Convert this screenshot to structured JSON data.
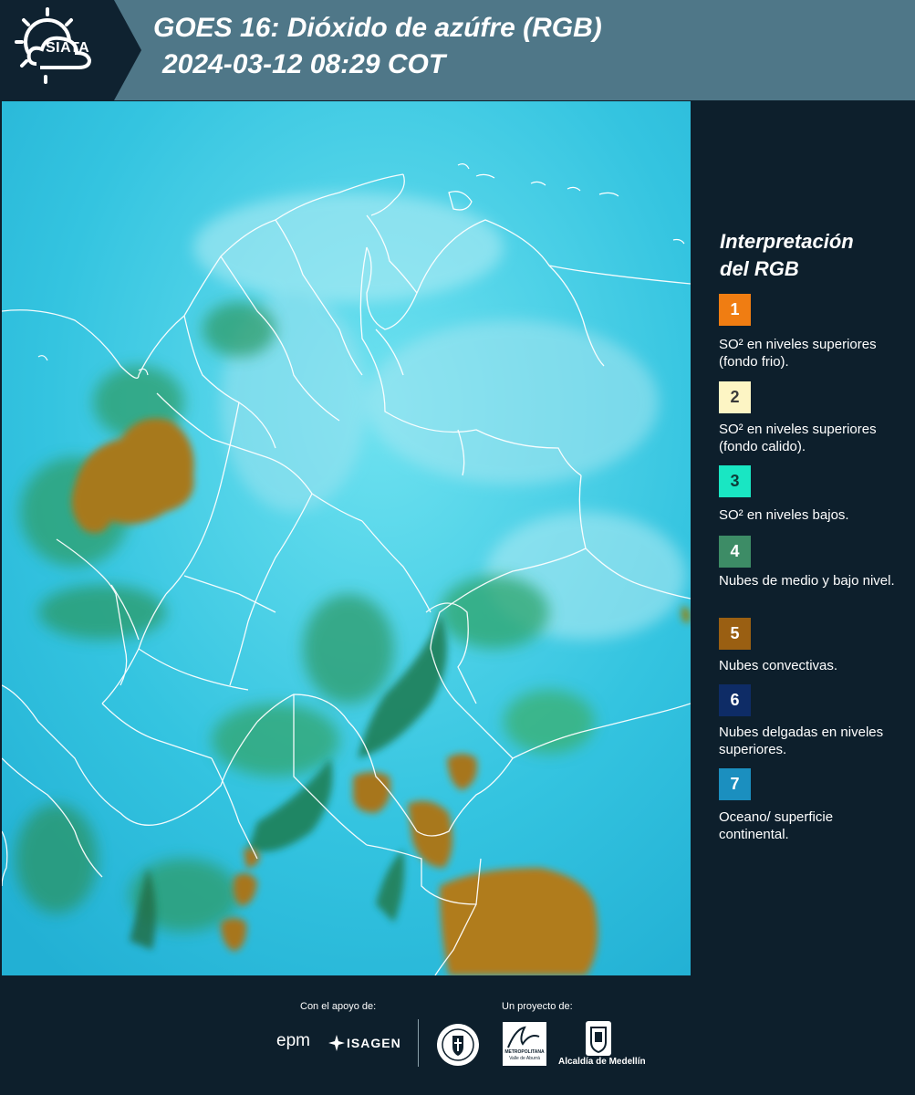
{
  "header": {
    "logo_text": "SIATA",
    "title_line1": "GOES 16: Dióxido de azúfre (RGB)",
    "title_line2": "2024-03-12 08:29 COT"
  },
  "legend": {
    "title_line1": "Interpretación",
    "title_line2": "del RGB",
    "items": [
      {
        "number": "1",
        "color": "#f07d12",
        "text_color": "#ffffff",
        "description": "SO² en niveles superiores (fondo frio)."
      },
      {
        "number": "2",
        "color": "#fdf5c4",
        "text_color": "#3a3a3a",
        "description": "SO² en niveles superiores (fondo calido)."
      },
      {
        "number": "3",
        "color": "#19e6c3",
        "text_color": "#0d3d3a",
        "description": "SO² en niveles bajos."
      },
      {
        "number": "4",
        "color": "#3d8c66",
        "text_color": "#ffffff",
        "description": "Nubes de medio y bajo nivel."
      },
      {
        "number": "5",
        "color": "#9a5f12",
        "text_color": "#ffffff",
        "description": "Nubes convectivas."
      },
      {
        "number": "6",
        "color": "#0e2c66",
        "text_color": "#ffffff",
        "description": "Nubes delgadas en niveles superiores."
      },
      {
        "number": "7",
        "color": "#1b8fbf",
        "text_color": "#ffffff",
        "description": "Oceano/ superficie continental."
      }
    ]
  },
  "footer": {
    "support_label": "Con el apoyo de:",
    "project_label": "Un proyecto de:",
    "brand_epm": "epm",
    "brand_isagen": "ISAGEN",
    "brand_area_line1": "METROPOLITANA",
    "brand_area_line2": "Valle de Aburrá",
    "brand_alcaldia": "Alcaldía de Medellín"
  }
}
